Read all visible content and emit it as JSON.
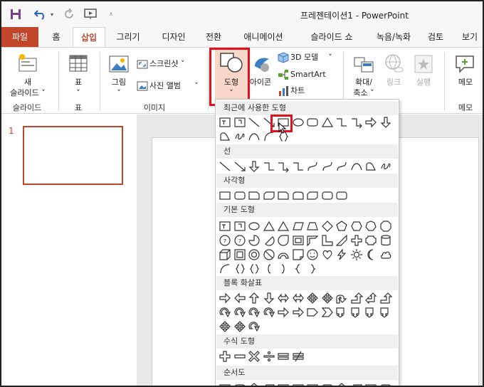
{
  "window": {
    "title": "프레젠테이션1 - PowerPoint"
  },
  "quick_access": {
    "icons": [
      "save-icon",
      "undo-icon",
      "redo-icon",
      "present-icon",
      "customize-icon"
    ]
  },
  "tabs": [
    "파일",
    "홈",
    "삽입",
    "그리기",
    "디자인",
    "전환",
    "애니메이션",
    "슬라이드 쇼",
    "녹음/녹화",
    "검토",
    "보기"
  ],
  "active_tab": "삽입",
  "ribbon": {
    "slides": {
      "new_line1": "새",
      "new_line2": "슬라이드 ˅",
      "group": "슬라이드"
    },
    "tables": {
      "table": "표",
      "caret": "˅",
      "group": "표"
    },
    "images": {
      "picture": "그림",
      "caret": "˅",
      "screenshot": "스크린샷 ˅",
      "album": "사진 앨범",
      "album_caret": "˅",
      "group": "이미지"
    },
    "illustrations": {
      "shapes": "도형",
      "shapes_caret": "˅",
      "icons": "아이콘",
      "model3d": "3D 모델",
      "model3d_caret": "˅",
      "smartart": "SmartArt",
      "chart": "차트"
    },
    "zoom": {
      "zoom_line1": "확대/",
      "zoom_line2": "축소 ˅",
      "link": "링크",
      "action": "실행"
    },
    "comments": {
      "comment": "메모",
      "group": "메모"
    }
  },
  "slides_pane": {
    "slide_number": "1"
  },
  "shapes_menu": {
    "categories": [
      "최근에 사용한 도형",
      "선",
      "사각형",
      "기본 도형",
      "블록 화살표",
      "수식 도형",
      "순서도"
    ],
    "selected_shape": "rectangle"
  },
  "colors": {
    "accent": "#c1462a",
    "highlight": "#e3111b"
  }
}
